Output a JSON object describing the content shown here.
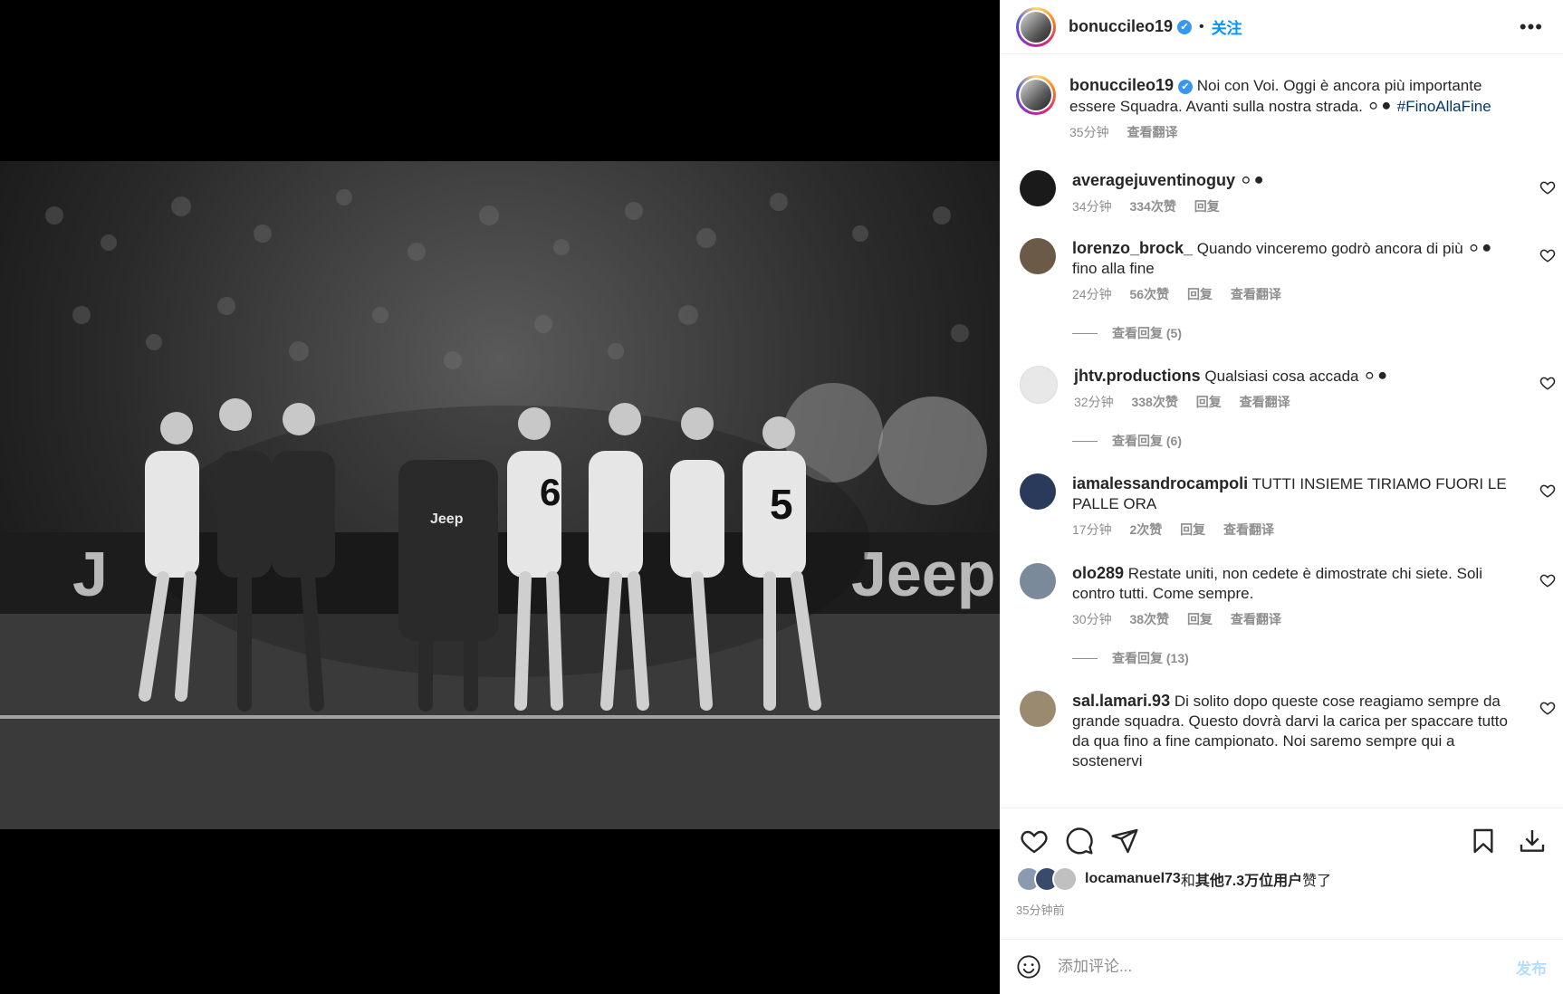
{
  "header": {
    "username": "bonuccileo19",
    "verified_mark": "✔",
    "separator": "•",
    "follow_label": "关注",
    "more_label": "•••"
  },
  "caption": {
    "username": "bonuccileo19",
    "text": " Noi con Voi. Oggi è ancora più importante essere Squadra. Avanti sulla nostra strada. ⚪⚫ ",
    "hashtag": "#FinoAllaFine",
    "time": "35分钟",
    "translate": "查看翻译"
  },
  "comments": [
    {
      "username": "averagejuventinoguy",
      "text": " ⚪⚫",
      "time": "34分钟",
      "likes": "334次赞",
      "reply": "回复",
      "translate": "",
      "replies": "",
      "avatar_color": "#1a1a1a"
    },
    {
      "username": "lorenzo_brock_",
      "text": " Quando vinceremo godrò ancora di più ⚪⚫ fino alla fine",
      "time": "24分钟",
      "likes": "56次赞",
      "reply": "回复",
      "translate": "查看翻译",
      "replies": "查看回复 (5)",
      "avatar_color": "#6b5a48"
    },
    {
      "username": "jhtv.productions",
      "text": " Qualsiasi cosa accada ⚪⚫",
      "time": "32分钟",
      "likes": "338次赞",
      "reply": "回复",
      "translate": "查看翻译",
      "replies": "查看回复 (6)",
      "avatar_color": "#e8e8e8"
    },
    {
      "username": "iamalessandrocampoli",
      "text": " TUTTI INSIEME TIRIAMO FUORI LE PALLE ORA",
      "time": "17分钟",
      "likes": "2次赞",
      "reply": "回复",
      "translate": "查看翻译",
      "replies": "",
      "avatar_color": "#2a3a5a"
    },
    {
      "username": "olo289",
      "text": " Restate uniti, non cedete è dimostrate chi siete. Soli contro tutti. Come sempre.",
      "time": "30分钟",
      "likes": "38次赞",
      "reply": "回复",
      "translate": "查看翻译",
      "replies": "查看回复 (13)",
      "avatar_color": "#7a8a9a"
    },
    {
      "username": "sal.lamari.93",
      "text": " Di solito dopo queste cose reagiamo sempre da grande squadra. Questo dovrà darvi la carica per spaccare tutto da qua fino a fine campionato. Noi saremo sempre qui a sostenervi",
      "time": "",
      "likes": "",
      "reply": "",
      "translate": "",
      "replies": "",
      "avatar_color": "#9a8a70"
    }
  ],
  "likes": {
    "user": "locamanuel73",
    "connector": "和",
    "others": "其他7.3万位用户",
    "suffix": "赞了"
  },
  "posted_time": "35分钟前",
  "add_comment": {
    "placeholder": "添加评论...",
    "post_label": "发布"
  },
  "colors": {
    "accent": "#0095f6",
    "verified": "#3897f0",
    "muted": "#8e8e8e",
    "post_disabled": "#b2dffc"
  },
  "icons": [
    "more-icon",
    "heart-icon",
    "comment-icon",
    "share-icon",
    "bookmark-icon",
    "download-icon",
    "emoji-icon",
    "verified-icon"
  ]
}
